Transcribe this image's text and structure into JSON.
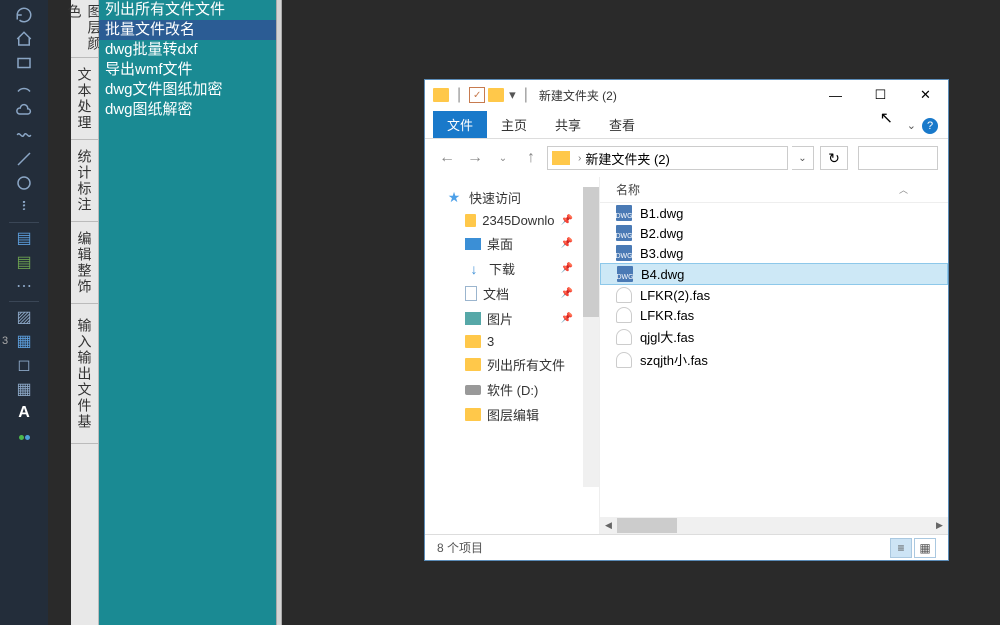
{
  "teal_categories": [
    "图层颜色",
    "文本处理",
    "统计标注",
    "编辑整饰",
    "输入输出文件基"
  ],
  "teal_items": [
    {
      "label": "列出所有文件文件",
      "hl": false
    },
    {
      "label": "批量文件改名",
      "hl": true
    },
    {
      "label": "dwg批量转dxf",
      "hl": false
    },
    {
      "label": "导出wmf文件",
      "hl": false
    },
    {
      "label": "dwg文件图纸加密",
      "hl": false
    },
    {
      "label": "dwg图纸解密",
      "hl": false
    }
  ],
  "explorer": {
    "title": "新建文件夹 (2)",
    "tabs": [
      "文件",
      "主页",
      "共享",
      "查看"
    ],
    "breadcrumb": "新建文件夹 (2)",
    "col_name": "名称",
    "nav": {
      "quick": "快速访问",
      "items": [
        {
          "label": "2345Downlo",
          "icon": "fold",
          "pin": true
        },
        {
          "label": "桌面",
          "icon": "desk",
          "pin": true
        },
        {
          "label": "下载",
          "icon": "down",
          "pin": true
        },
        {
          "label": "文档",
          "icon": "doc",
          "pin": true
        },
        {
          "label": "图片",
          "icon": "pic",
          "pin": true
        },
        {
          "label": "3",
          "icon": "fold",
          "pin": false
        },
        {
          "label": "列出所有文件",
          "icon": "fold",
          "pin": false
        },
        {
          "label": "软件 (D:)",
          "icon": "drive",
          "pin": false
        },
        {
          "label": "图层编辑",
          "icon": "fold",
          "pin": false
        }
      ]
    },
    "files": [
      {
        "name": "B1.dwg",
        "type": "dwg",
        "sel": false
      },
      {
        "name": "B2.dwg",
        "type": "dwg",
        "sel": false
      },
      {
        "name": "B3.dwg",
        "type": "dwg",
        "sel": false
      },
      {
        "name": "B4.dwg",
        "type": "dwg",
        "sel": true
      },
      {
        "name": "LFKR(2).fas",
        "type": "fas",
        "sel": false
      },
      {
        "name": "LFKR.fas",
        "type": "fas",
        "sel": false
      },
      {
        "name": "qjgl大.fas",
        "type": "fas",
        "sel": false
      },
      {
        "name": "szqjth小.fas",
        "type": "fas",
        "sel": false
      }
    ],
    "status": "8 个项目"
  },
  "num3": "3"
}
